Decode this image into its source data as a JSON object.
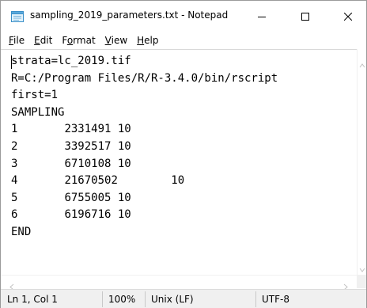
{
  "window": {
    "title": "sampling_2019_parameters.txt - Notepad"
  },
  "icons": {
    "app": "notepad-icon",
    "minimize": "minimize-icon",
    "maximize": "maximize-icon",
    "close": "close-icon"
  },
  "menu": {
    "items": [
      {
        "label": "File",
        "mnemonic": "F"
      },
      {
        "label": "Edit",
        "mnemonic": "E"
      },
      {
        "label": "Format",
        "mnemonic": "o"
      },
      {
        "label": "View",
        "mnemonic": "V"
      },
      {
        "label": "Help",
        "mnemonic": "H"
      }
    ]
  },
  "editor": {
    "lines": [
      "strata=lc_2019.tif",
      "R=C:/Program Files/R/R-3.4.0/bin/rscript",
      "first=1",
      "SAMPLING",
      "1\t2331491 10",
      "2\t3392517 10",
      "3\t6710108 10",
      "4\t21670502\t10",
      "5\t6755005 10",
      "6\t6196716 10",
      "END"
    ]
  },
  "status": {
    "position": "Ln 1, Col 1",
    "zoom": "100%",
    "line_endings": "Unix (LF)",
    "encoding": "UTF-8"
  }
}
